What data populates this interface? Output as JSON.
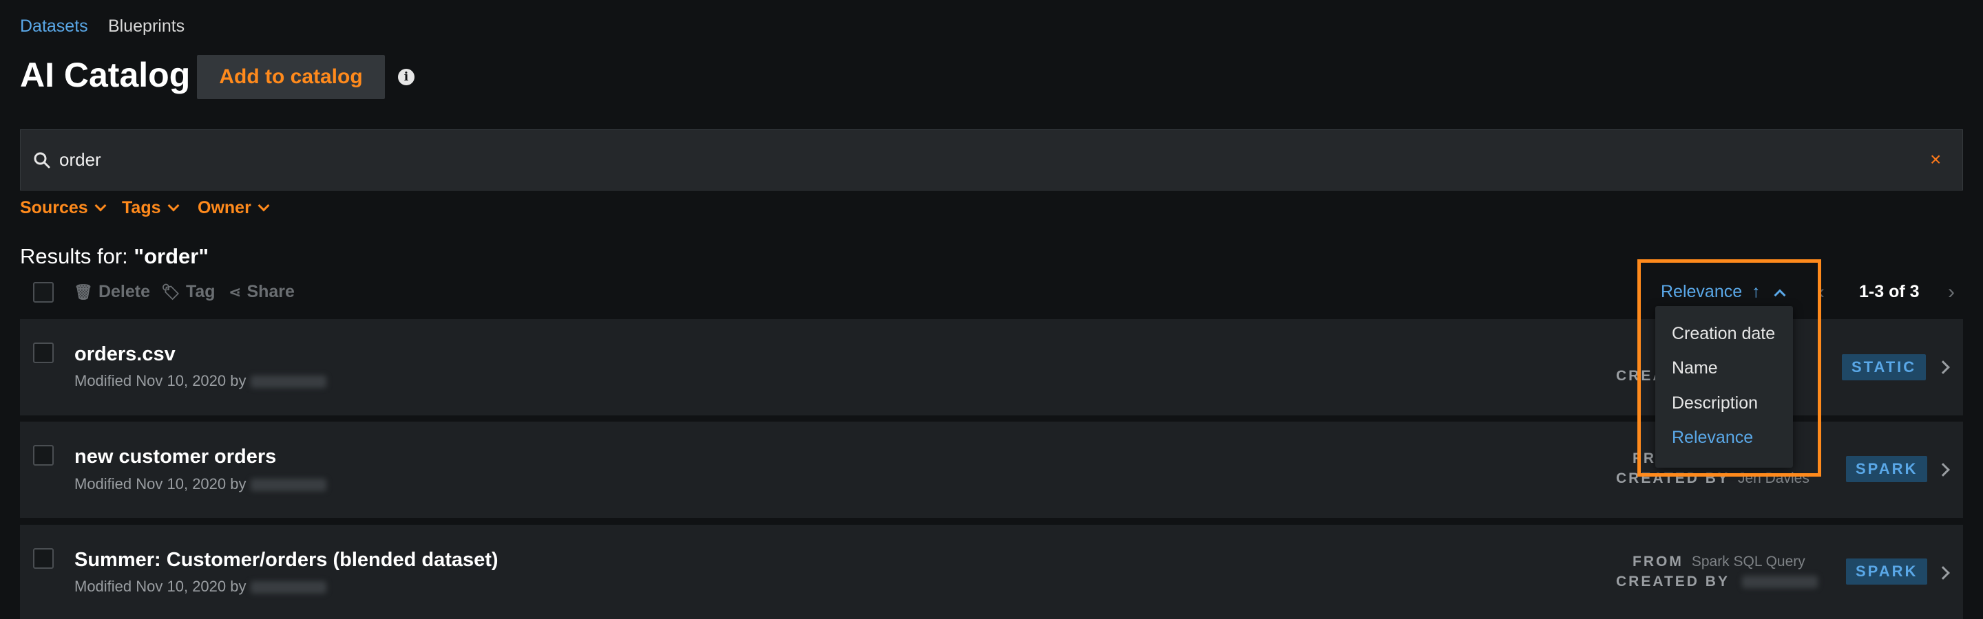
{
  "nav": {
    "datasets": "Datasets",
    "blueprints": "Blueprints"
  },
  "header": {
    "title": "AI Catalog",
    "add_button": "Add to catalog",
    "info_icon": "info-icon"
  },
  "search": {
    "value": "order",
    "placeholder": "",
    "clear_symbol": "×"
  },
  "filters": {
    "sources": "Sources",
    "tags": "Tags",
    "owner": "Owner"
  },
  "results": {
    "prefix": "Results for: ",
    "query": "\"order\""
  },
  "toolbar": {
    "delete": "Delete",
    "tag": "Tag",
    "share": "Share"
  },
  "pager": {
    "range": "1-3 of 3"
  },
  "sort": {
    "current": "Relevance",
    "direction_symbol": "↑",
    "options": [
      "Creation date",
      "Name",
      "Description",
      "Relevance"
    ],
    "selected": "Relevance"
  },
  "rows": [
    {
      "title": "orders.csv",
      "modified": "Modified Nov 10, 2020 by",
      "from_label": "",
      "from_value": "",
      "created_label": "CREA",
      "created_value": "",
      "badge": "STATIC"
    },
    {
      "title": "new customer orders",
      "modified": "Modified Nov 10, 2020 by",
      "from_label": "FRO",
      "from_value": "",
      "created_label": "CREATED BY",
      "created_value": "Jen Davies",
      "badge": "SPARK"
    },
    {
      "title": "Summer: Customer/orders (blended dataset)",
      "modified": "Modified Nov 10, 2020 by",
      "from_label": "FROM",
      "from_value": "Spark SQL Query",
      "created_label": "CREATED BY",
      "created_value": "",
      "badge": "SPARK"
    }
  ],
  "colors": {
    "accent": "#ff8a1c",
    "link": "#5aa8e8",
    "badge_bg": "#1f4866",
    "background": "#101214"
  }
}
